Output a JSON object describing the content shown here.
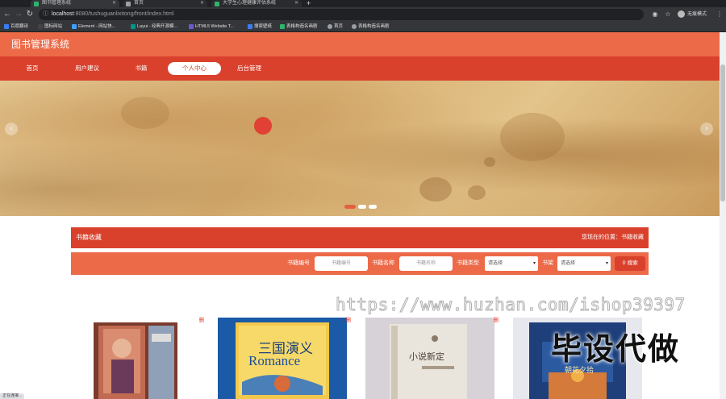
{
  "browser": {
    "tabs": [
      {
        "label": "图书管理系统",
        "favicon_color": "#2fb36b"
      },
      {
        "label": "首页",
        "favicon_color": "#9aa0a6"
      },
      {
        "label": "大学生心理健康评估系统",
        "favicon_color": "#2fb36b"
      }
    ],
    "url_host": "localhost",
    "url_path": ":8080/tushuguanlixitong/front/index.html",
    "profile_label": "无痕模式",
    "bookmarks": [
      {
        "label": "百度翻译",
        "color": "#3b7cf5"
      },
      {
        "label": "图标网站",
        "color": "#444"
      },
      {
        "label": "Element - 网站快...",
        "color": "#409eff"
      },
      {
        "label": "Layui - 经典开源模...",
        "color": "#009688"
      },
      {
        "label": "HTML5 Website T...",
        "color": "#6a5acd"
      },
      {
        "label": "搜索壁纸",
        "color": "#3b7cf5"
      },
      {
        "label": "表格构造名画剧",
        "color": "#2fb36b"
      },
      {
        "label": "首页",
        "color": "#9aa0a6"
      },
      {
        "label": "表格构造名画剧",
        "color": "#9aa0a6"
      }
    ]
  },
  "site": {
    "title": "图书管理系统",
    "nav": [
      "首页",
      "用户建议",
      "书籍",
      "个人中心",
      "后台管理"
    ],
    "active_nav": "个人中心"
  },
  "section": {
    "title": "书籍收藏",
    "breadcrumb": "您现在的位置：书籍收藏"
  },
  "search": {
    "fields": [
      {
        "label": "书籍编号",
        "placeholder": "书籍编号"
      },
      {
        "label": "书籍名称",
        "placeholder": "书籍名称"
      }
    ],
    "type_label": "书籍类型",
    "type_value": "请选择",
    "shelf_label": "书架",
    "shelf_value": "请选择",
    "button_label": "搜索"
  },
  "books": [
    {
      "delete_label": "删",
      "cover_title": ""
    },
    {
      "delete_label": "删",
      "cover_title": "三国演义",
      "cover_subtitle": "Romance"
    },
    {
      "delete_label": "删",
      "cover_title": "小说新定"
    },
    {
      "delete_label": "删",
      "cover_title": "朝花夕拾"
    }
  ],
  "watermark": {
    "url": "https://www.huzhan.com/ishop39397",
    "text": "毕设代做"
  },
  "status_text": "正在连接..."
}
